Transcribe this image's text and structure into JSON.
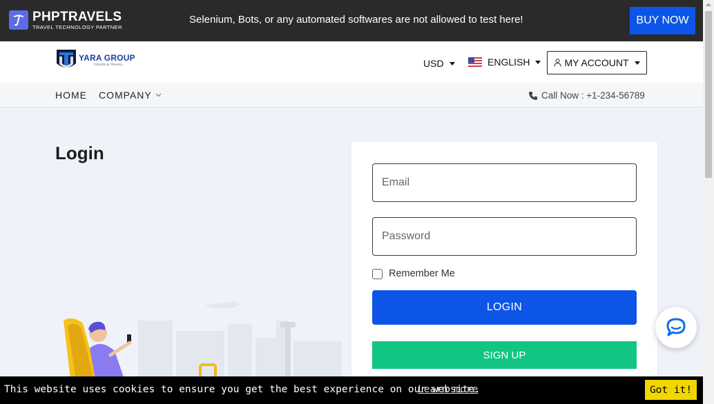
{
  "topbar": {
    "brand_name": "PHPTRAVELS",
    "brand_tagline": "TRAVEL TECHNOLOGY PARTNER",
    "promo_text": "Selenium, Bots, or any automated softwares are not allowed to test here!",
    "buy_label": "BUY NOW",
    "buy_color": "#0d55e6"
  },
  "header": {
    "logo_name": "YARA GROUP",
    "logo_tagline": "TOURS & TRAVEL",
    "currency": "USD",
    "language": "ENGLISH",
    "account_label": "MY ACCOUNT"
  },
  "nav": {
    "items": [
      {
        "label": "HOME"
      },
      {
        "label": "COMPANY"
      }
    ],
    "call_now": "Call Now : +1-234-56789"
  },
  "login": {
    "title": "Login",
    "email_placeholder": "Email",
    "password_placeholder": "Password",
    "remember_label": "Remember Me",
    "login_label": "LOGIN",
    "signup_label": "SIGN UP",
    "login_color": "#0d55e6",
    "signup_color": "#13c583"
  },
  "cookie": {
    "text": "This website uses cookies to ensure you get the best experience on our website.",
    "link_label": "Learn more",
    "button_label": "Got it!",
    "button_color": "#f1d600"
  },
  "icons": {
    "brand": "phptravels-logo-icon",
    "flag": "us-flag-icon",
    "account": "user-icon",
    "phone": "phone-icon",
    "chat": "chat-bubble-icon"
  }
}
